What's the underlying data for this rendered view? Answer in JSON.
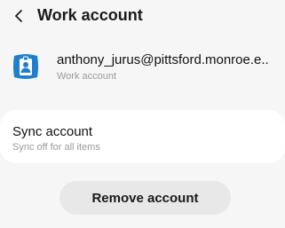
{
  "header": {
    "title": "Work account",
    "back_icon": "chevron-left-icon"
  },
  "account": {
    "email": "anthony_jurus@pittsford.monroe.e..",
    "type_label": "Work account",
    "icon": "work-profile-icon",
    "icon_color": "#1f7fcf"
  },
  "sync": {
    "title": "Sync account",
    "status": "Sync off for all items"
  },
  "actions": {
    "remove_label": "Remove account"
  }
}
